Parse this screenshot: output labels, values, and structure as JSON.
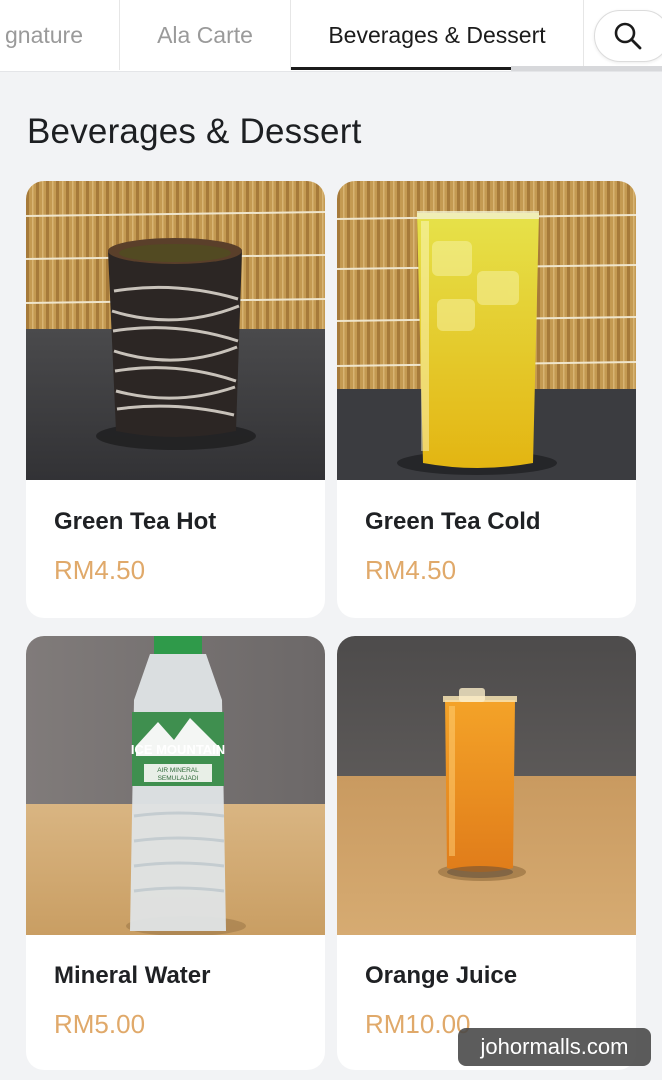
{
  "tabs": [
    {
      "label": "gnature"
    },
    {
      "label": "Ala Carte"
    },
    {
      "label": "Beverages & Dessert"
    }
  ],
  "search": {
    "icon": "search-icon"
  },
  "section": {
    "title": "Beverages & Dessert"
  },
  "products": [
    {
      "name": "Green Tea Hot",
      "price": "RM4.50"
    },
    {
      "name": "Green Tea Cold",
      "price": "RM4.50"
    },
    {
      "name": "Mineral Water",
      "price": "RM5.00"
    },
    {
      "name": "Orange Juice",
      "price": "RM10.00"
    }
  ],
  "bottle": {
    "brand": "ICE MOUNTAIN",
    "line1": "AIR MINERAL",
    "line2": "SEMULAJADI"
  },
  "watermark": {
    "text": "johormalls.com"
  },
  "colors": {
    "price": "#e0a96a",
    "active_tab": "#1b1b1b",
    "background": "#f2f3f5"
  }
}
